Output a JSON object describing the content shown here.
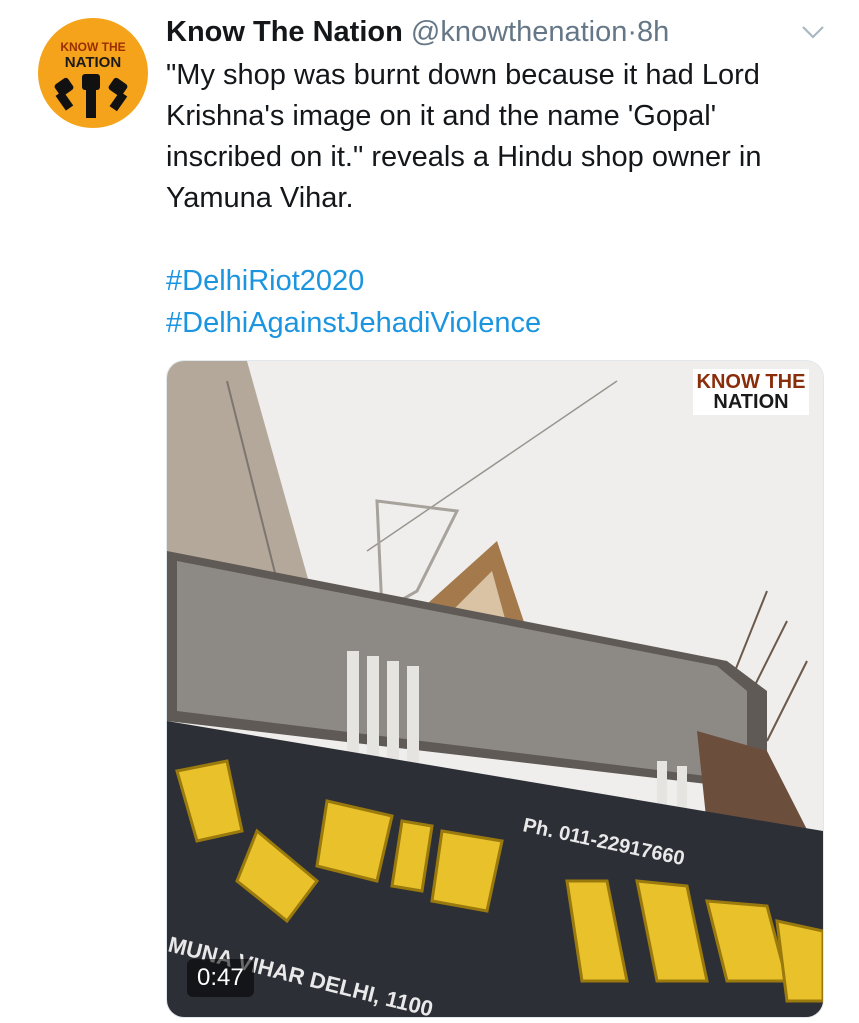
{
  "tweet": {
    "author_name": "Know The Nation",
    "author_handle": "@knowthenation",
    "separator": "·",
    "time_ago": "8h",
    "avatar_line1": "KNOW THE",
    "avatar_line2": "NATION",
    "text": "\"My shop was burnt down because it had Lord Krishna's image on it and the name 'Gopal' inscribed on it.\" reveals a Hindu shop owner in Yamuna Vihar.",
    "hashtags": [
      "#DelhiRiot2020",
      "#DelhiAgainstJehadiViolence"
    ]
  },
  "media": {
    "duration": "0:47",
    "watermark_line1": "KNOW THE",
    "watermark_line2": "NATION",
    "sign_phone": "Ph. 011-22917660",
    "sign_bottom": "MUNA VIHAR DELHI, 1100"
  },
  "colors": {
    "link": "#1b95e0",
    "secondary": "#657786",
    "avatar_bg": "#f5a31a"
  }
}
